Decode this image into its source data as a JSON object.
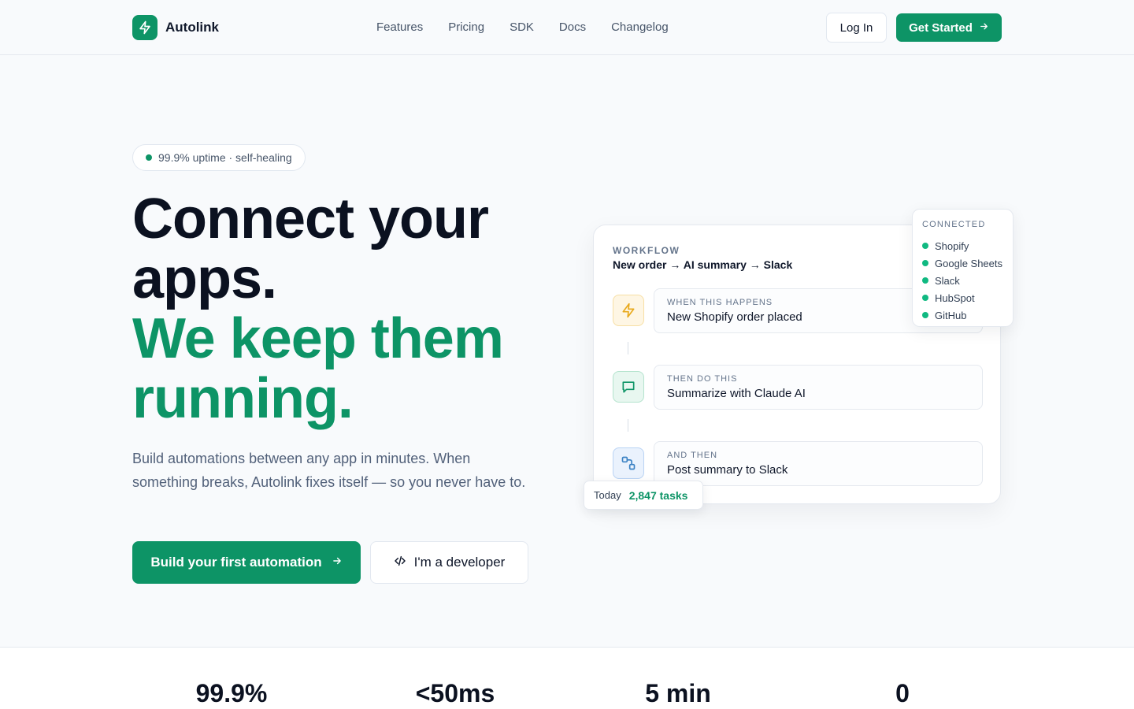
{
  "nav": {
    "brand": "Autolink",
    "links": [
      "Features",
      "Pricing",
      "SDK",
      "Docs",
      "Changelog"
    ],
    "login_label": "Log In",
    "get_started_label": "Get Started"
  },
  "hero": {
    "pill_text": "99.9% uptime · self-healing",
    "headline_line1": "Connect your",
    "headline_line2": "apps.",
    "headline_line3": "We keep them",
    "headline_line4": "running.",
    "subtext": "Build automations between any app in minutes. When something breaks, Autolink fixes itself — so you never have to.",
    "primary_cta": "Build your first automation",
    "secondary_cta": "I'm a developer"
  },
  "workflow": {
    "label": "WORKFLOW",
    "title": "New order → AI summary → Slack",
    "steps": [
      {
        "kicker": "WHEN THIS HAPPENS",
        "text": "New Shopify order placed",
        "icon": "lightning-icon"
      },
      {
        "kicker": "THEN DO THIS",
        "text": "Summarize with Claude AI",
        "icon": "chat-bubble-icon"
      },
      {
        "kicker": "AND THEN",
        "text": "Post summary to Slack",
        "icon": "link-nodes-icon"
      }
    ]
  },
  "connected": {
    "label": "CONNECTED",
    "apps": [
      "Shopify",
      "Google Sheets",
      "Slack",
      "HubSpot",
      "GitHub"
    ]
  },
  "today": {
    "label": "Today",
    "value": "2,847 tasks"
  },
  "stats": [
    "99.9%",
    "<50ms",
    "5 min",
    "0"
  ],
  "colors": {
    "brand": "#0d9466",
    "dot": "#10b981",
    "trigger_icon": "#e8a91c",
    "ai_icon": "#0d9466",
    "slack_icon": "#3b82c4"
  }
}
